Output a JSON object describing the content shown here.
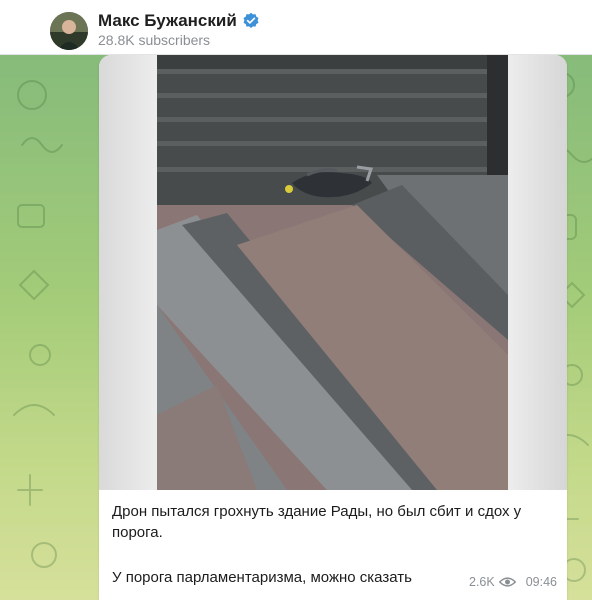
{
  "channel": {
    "name": "Макс Бужанский",
    "subscribers": "28.8K subscribers",
    "verified_icon": "verified-badge-icon"
  },
  "post": {
    "text_line_1": "Дрон пытался грохнуть здание Рады, но был сбит и сдох у порога.",
    "text_line_2": "У порога парламентаризма, можно сказать",
    "views": "2.6K",
    "time": "09:46"
  },
  "colors": {
    "accent": "#3d91d8",
    "meta_gray": "#8a8f94",
    "chat_bg_top": "#86bb7a",
    "chat_bg_bottom": "#d6e09a"
  }
}
